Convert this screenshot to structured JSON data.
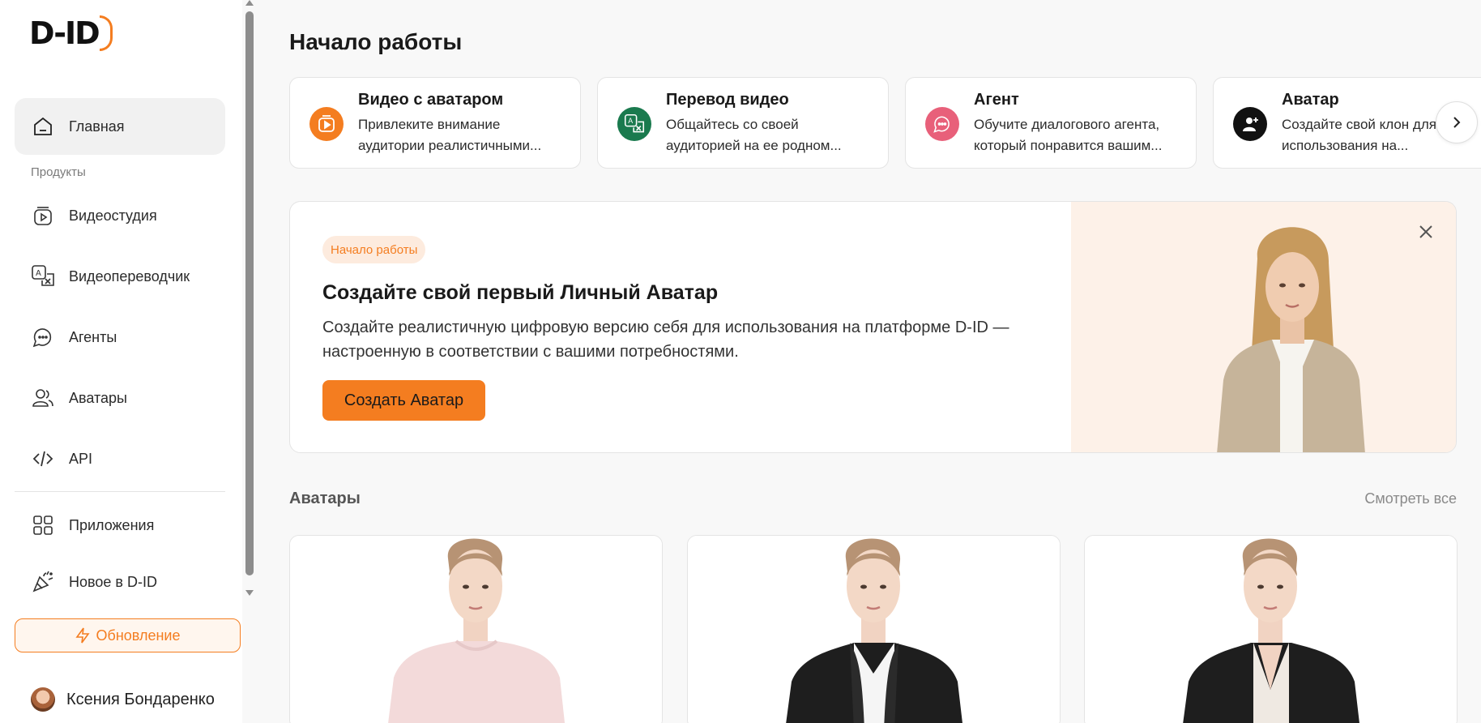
{
  "brand": {
    "logo_text": "D-ID",
    "accent": "#f47d20"
  },
  "sidebar": {
    "home_label": "Главная",
    "products_label": "Продукты",
    "items": [
      {
        "label": "Видеостудия",
        "icon": "video-studio-icon"
      },
      {
        "label": "Видеопереводчик",
        "icon": "translate-icon"
      },
      {
        "label": "Агенты",
        "icon": "agent-chat-icon"
      },
      {
        "label": "Аватары",
        "icon": "users-icon"
      },
      {
        "label": "API",
        "icon": "code-icon"
      }
    ],
    "apps_label": "Приложения",
    "whats_new_label": "Новое в D-ID",
    "upgrade_label": "Обновление",
    "user_name": "Ксения Бондаренко"
  },
  "main": {
    "title": "Начало работы",
    "quick_cards": [
      {
        "title": "Видео с аватаром",
        "desc1": "Привлеките внимание",
        "desc2": "аудитории реалистичными...",
        "icon": "video-avatar-icon",
        "color": "#f47d20"
      },
      {
        "title": "Перевод видео",
        "desc1": "Общайтесь со своей",
        "desc2": "аудиторией на ее родном...",
        "icon": "translate-icon",
        "color": "#1a7a4e"
      },
      {
        "title": "Агент",
        "desc1": "Обучите диалогового агента,",
        "desc2": "который понравится вашим...",
        "icon": "agent-chat-icon",
        "color": "#e8607a"
      },
      {
        "title": "Аватар",
        "desc1": "Создайте свой клон для",
        "desc2": "использования на...",
        "icon": "user-plus-icon",
        "color": "#111111"
      }
    ],
    "banner": {
      "badge": "Начало работы",
      "title": "Создайте свой первый Личный Аватар",
      "desc": "Создайте реалистичную цифровую версию себя для использования на платформе D-ID — настроенную в соответствии с вашими потребностями.",
      "cta": "Создать Аватар"
    },
    "avatars_section": {
      "title": "Аватары",
      "see_all": "Смотреть все"
    }
  }
}
